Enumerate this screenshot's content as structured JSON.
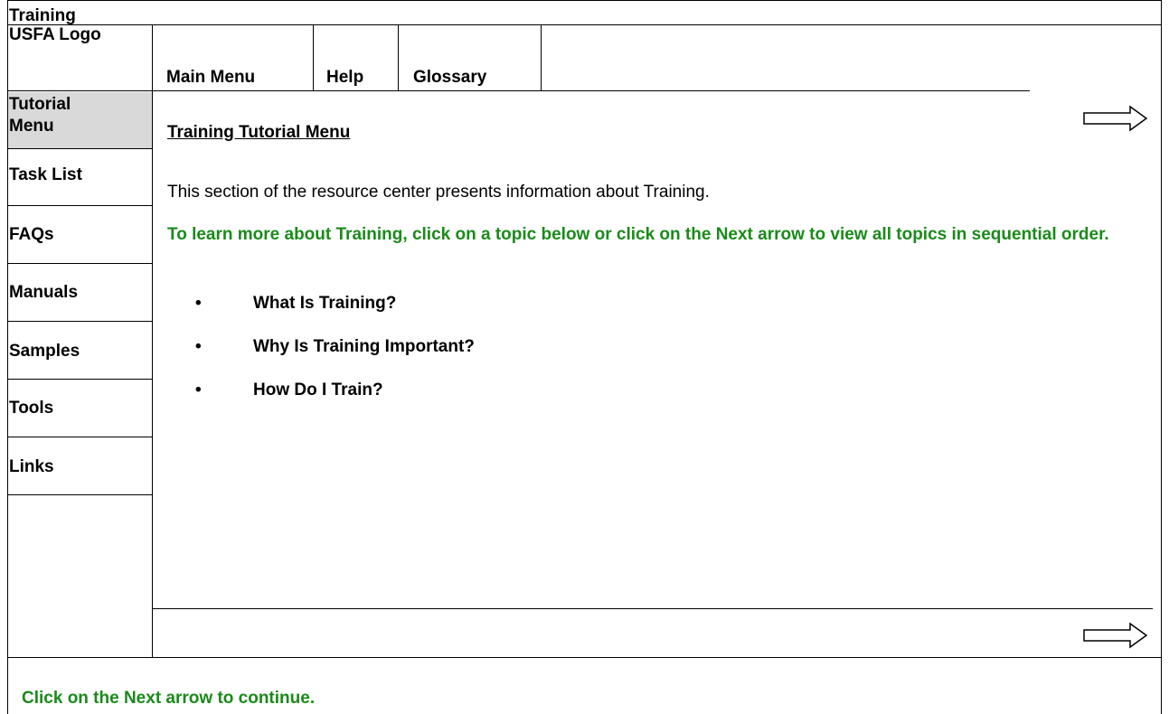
{
  "window": {
    "title": "Training"
  },
  "header": {
    "logo": "USFA Logo"
  },
  "nav": {
    "main_menu": "Main Menu",
    "help": "Help",
    "glossary": "Glossary"
  },
  "sidebar": {
    "items": [
      {
        "label": "Tutorial Menu"
      },
      {
        "label": "Task List"
      },
      {
        "label": "FAQs"
      },
      {
        "label": "Manuals"
      },
      {
        "label": "Samples"
      },
      {
        "label": "Tools"
      },
      {
        "label": "Links"
      }
    ]
  },
  "content": {
    "title": "Training Tutorial Menu",
    "description": "This section of the resource center presents information about Training.",
    "instruction": "To learn more about Training, click on a topic below or click on the Next arrow to view all topics in sequential order.",
    "topics": [
      {
        "label": "What Is Training?"
      },
      {
        "label": "Why Is Training Important?"
      },
      {
        "label": "How Do I Train?"
      }
    ],
    "bullet": "•"
  },
  "footer": {
    "instruction": "Click on the Next arrow to continue."
  },
  "icons": {
    "next": "right-arrow-icon"
  },
  "colors": {
    "instruction_text": "#1a8a1a",
    "selected_sidebar": "#d9d9d9"
  }
}
